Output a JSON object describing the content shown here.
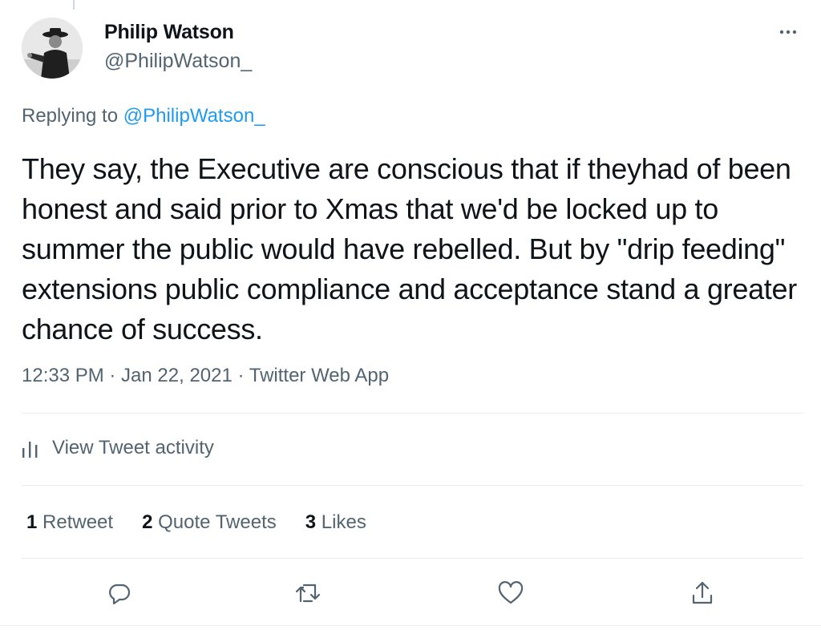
{
  "author": {
    "name": "Philip Watson",
    "handle": "@PhilipWatson_"
  },
  "reply": {
    "prefix": "Replying to ",
    "target": "@PhilipWatson_"
  },
  "tweet": {
    "text": "They say, the Executive are conscious that if theyhad of been honest and said prior to Xmas that we'd be locked up to summer the public would have rebelled. But by \"drip feeding\" extensions public compliance and acceptance stand a greater chance of success.",
    "meta": "12:33 PM · Jan 22, 2021 · Twitter Web App"
  },
  "activity": {
    "label": "View Tweet activity",
    "icon": "bar-chart-icon"
  },
  "stats": {
    "retweets_count": "1",
    "retweets_label": "Retweet",
    "quotes_count": "2",
    "quotes_label": "Quote Tweets",
    "likes_count": "3",
    "likes_label": "Likes"
  },
  "actions": {
    "reply_icon": "reply-icon",
    "retweet_icon": "retweet-icon",
    "like_icon": "heart-icon",
    "share_icon": "share-icon"
  },
  "colors": {
    "accent": "#1d9bf0",
    "muted_text": "#536471",
    "text": "#0f1419",
    "divider": "#e6ecf0"
  }
}
